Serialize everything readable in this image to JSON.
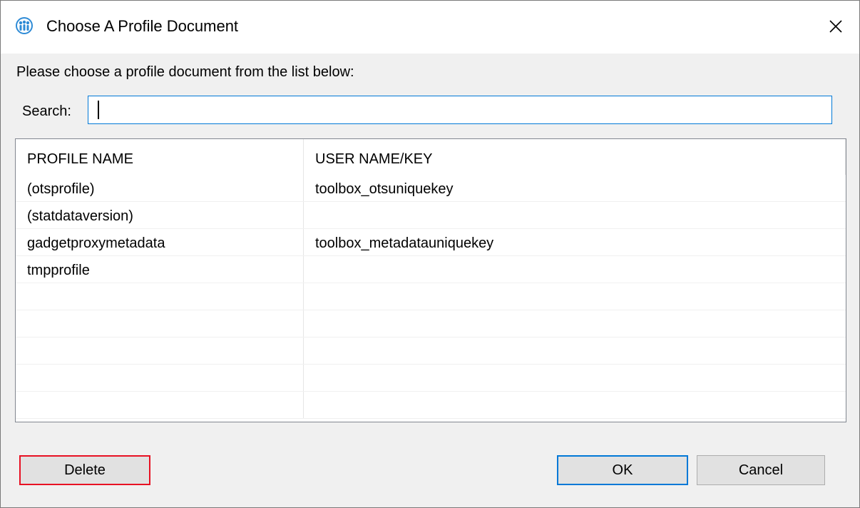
{
  "window": {
    "title": "Choose A Profile Document"
  },
  "prompt": "Please choose a profile document from the list below:",
  "search": {
    "label": "Search:",
    "value": ""
  },
  "list": {
    "columns": [
      "PROFILE NAME",
      "USER NAME/KEY"
    ],
    "rows": [
      [
        "(otsprofile)",
        "toolbox_otsuniquekey"
      ],
      [
        "(statdataversion)",
        ""
      ],
      [
        "gadgetproxymetadata",
        "toolbox_metadatauniquekey"
      ],
      [
        "tmpprofile",
        ""
      ],
      [
        "",
        ""
      ],
      [
        "",
        ""
      ],
      [
        "",
        ""
      ],
      [
        "",
        ""
      ],
      [
        "",
        ""
      ]
    ]
  },
  "buttons": {
    "delete": "Delete",
    "ok": "OK",
    "cancel": "Cancel"
  },
  "colors": {
    "accent": "#0078d7",
    "delete_border": "#e81123"
  }
}
